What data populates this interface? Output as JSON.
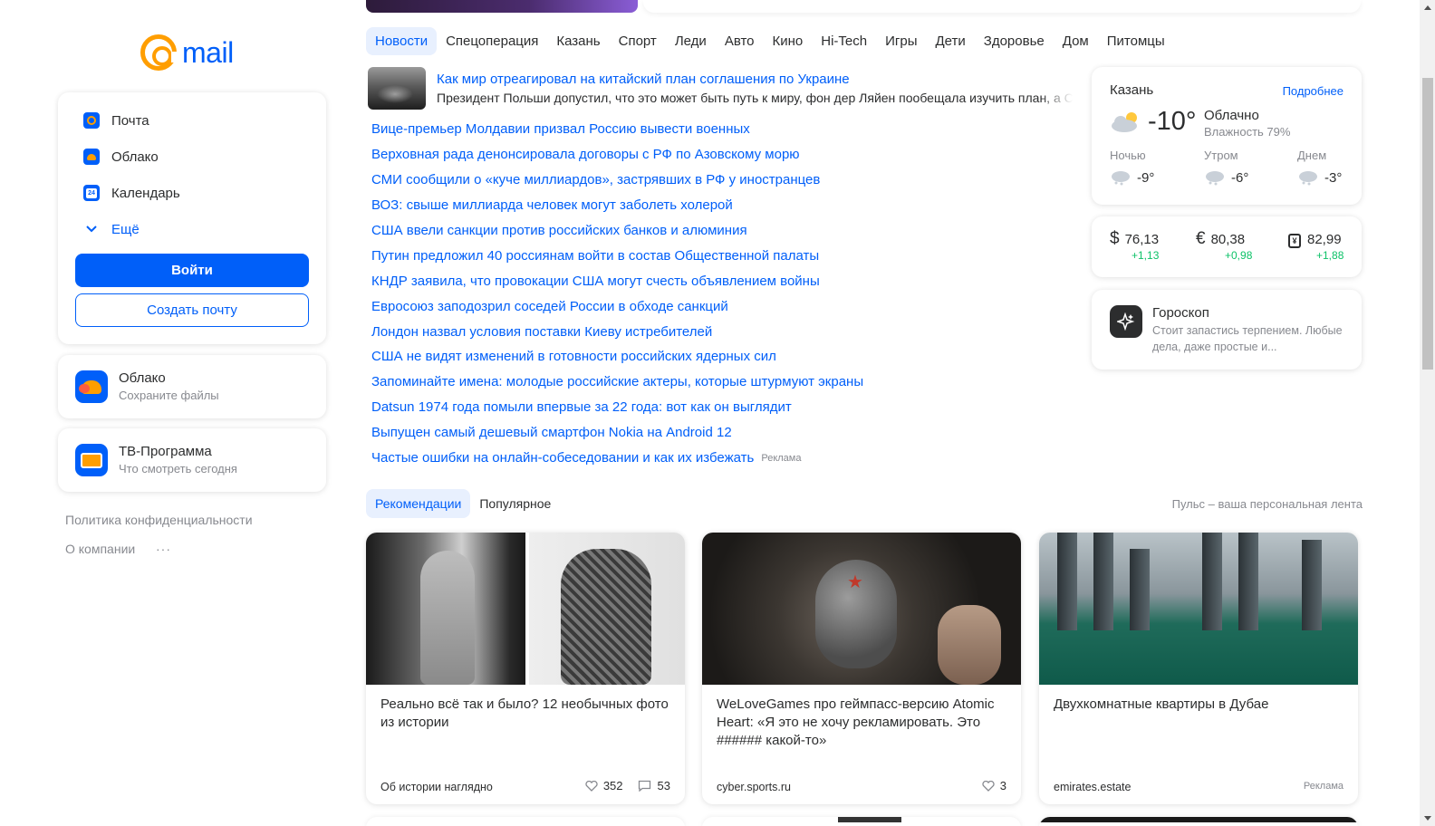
{
  "logo": {
    "text": "mail"
  },
  "services": {
    "items": [
      {
        "label": "Почта",
        "icon": "mail-icon"
      },
      {
        "label": "Облако",
        "icon": "cloud-icon"
      },
      {
        "label": "Календарь",
        "icon": "calendar-icon",
        "badge": "24"
      },
      {
        "label": "Ещё",
        "icon": "chevron-down-icon"
      }
    ],
    "login_label": "Войти",
    "create_label": "Создать почту"
  },
  "promos": [
    {
      "title": "Облако",
      "subtitle": "Сохраните файлы",
      "icon": "cloud-app-icon"
    },
    {
      "title": "ТВ-Программа",
      "subtitle": "Что смотреть сегодня",
      "icon": "tv-icon"
    }
  ],
  "footer": {
    "privacy": "Политика конфиденциальности",
    "about": "О компании",
    "more": "···"
  },
  "news_tabs": [
    "Новости",
    "Спецоперация",
    "Казань",
    "Спорт",
    "Леди",
    "Авто",
    "Кино",
    "Hi-Tech",
    "Игры",
    "Дети",
    "Здоровье",
    "Дом",
    "Питомцы"
  ],
  "news": {
    "lead_title": "Как мир отреагировал на китайский план соглашения по Украине",
    "lead_sub": "Президент Польши допустил, что это может быть путь к миру, фон дер Ляйен пообещала изучить план, а С",
    "items": [
      "Вице-премьер Молдавии призвал Россию вывести военных",
      "Верховная рада денонсировала договоры с РФ по Азовскому морю",
      "СМИ сообщили о «куче миллиардов», застрявших в РФ у иностранцев",
      "ВОЗ: свыше миллиарда человек могут заболеть холерой",
      "США ввели санкции против российских банков и алюминия",
      "Путин предложил 40 россиянам войти в состав Общественной палаты",
      "КНДР заявила, что провокации США могут счесть объявлением войны",
      "Евросоюз заподозрил соседей России в обходе санкций",
      "Лондон назвал условия поставки Киеву истребителей",
      "США не видят изменений в готовности российских ядерных сил",
      "Запоминайте имена: молодые российские актеры, которые штурмуют экраны",
      "Datsun 1974 года помыли впервые за 22 года: вот как он выглядит",
      "Выпущен самый дешевый смартфон Nokia на Android 12",
      "Частые ошибки на онлайн-собеседовании и как их избежать"
    ],
    "ad_label": "Реклама"
  },
  "weather": {
    "city": "Казань",
    "more": "Подробнее",
    "temp": "-10°",
    "condition": "Облачно",
    "humidity": "Влажность 79%",
    "parts": [
      {
        "label": "Ночью",
        "temp": "-9°"
      },
      {
        "label": "Утром",
        "temp": "-6°"
      },
      {
        "label": "Днем",
        "temp": "-3°"
      }
    ]
  },
  "currency": [
    {
      "symbol": "$",
      "value": "76,13",
      "delta": "+1,13"
    },
    {
      "symbol": "€",
      "value": "80,38",
      "delta": "+0,98"
    },
    {
      "symbol": "¥",
      "value": "82,99",
      "delta": "+1,88"
    }
  ],
  "horoscope": {
    "title": "Гороскоп",
    "text": "Стоит запастись терпением. Любые дела, даже простые и..."
  },
  "feed": {
    "tabs": [
      "Рекомендации",
      "Популярное"
    ],
    "pulse": "Пульс – ваша персональная лента",
    "cards": [
      {
        "title": "Реально всё так и было? 12 необычных фото из истории",
        "source": "Об истории наглядно",
        "likes": "352",
        "comments": "53"
      },
      {
        "title": "WeLoveGames про геймпасс-версию Atomic Heart: «Я это не хочу рекламировать. Это ###### какой-то»",
        "source": "cyber.sports.ru",
        "likes": "3"
      },
      {
        "title": "Двухкомнатные квартиры в Дубае",
        "source": "emirates.estate",
        "ad": "Реклама"
      }
    ]
  },
  "colors": {
    "accent": "#005ff9",
    "brand_orange": "#ff9e00",
    "positive": "#0dc268",
    "muted": "#87898f"
  }
}
